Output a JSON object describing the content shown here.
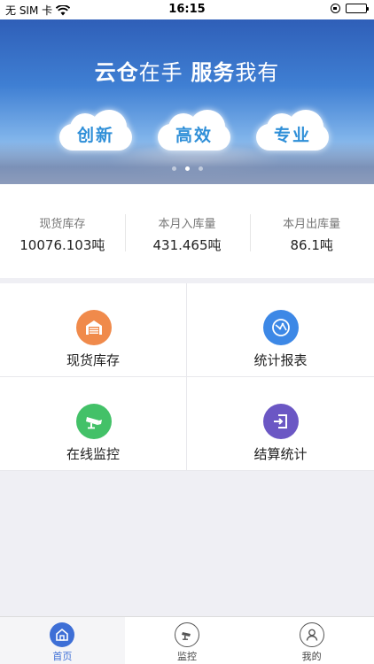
{
  "status_bar": {
    "carrier": "无 SIM 卡",
    "time": "16:15"
  },
  "banner": {
    "title_bold_1": "云仓",
    "title_thin_1": "在手",
    "title_bold_2": "服务",
    "title_thin_2": "我有",
    "clouds": [
      "创新",
      "高效",
      "专业"
    ]
  },
  "stats": [
    {
      "label": "现货库存",
      "value": "10076.103吨"
    },
    {
      "label": "本月入库量",
      "value": "431.465吨"
    },
    {
      "label": "本月出库量",
      "value": "86.1吨"
    }
  ],
  "menu": [
    {
      "label": "现货库存",
      "icon": "warehouse-icon",
      "color": "#f08a4b"
    },
    {
      "label": "统计报表",
      "icon": "report-icon",
      "color": "#3d88e6"
    },
    {
      "label": "在线监控",
      "icon": "camera-icon",
      "color": "#43c168"
    },
    {
      "label": "结算统计",
      "icon": "settlement-icon",
      "color": "#6b57c4"
    }
  ],
  "tabbar": [
    {
      "label": "首页",
      "icon": "home-icon"
    },
    {
      "label": "监控",
      "icon": "monitor-icon"
    },
    {
      "label": "我的",
      "icon": "profile-icon"
    }
  ]
}
